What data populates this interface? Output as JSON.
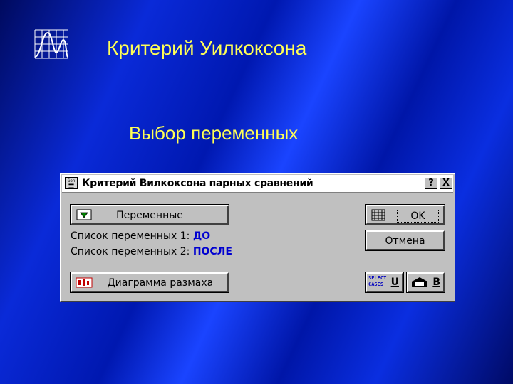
{
  "slide": {
    "title": "Критерий Уилкоксона",
    "subtitle": "Выбор переменных",
    "logo_icon": "distribution-chart-icon"
  },
  "dialog": {
    "title": "Критерий Вилкоксона парных сравнений",
    "help_label": "?",
    "close_label": "X",
    "variables_button": "Переменные",
    "var_list_1_label": "Список переменных 1:",
    "var_list_1_value": "ДО",
    "var_list_2_label": "Список переменных 2:",
    "var_list_2_value": "ПОСЛЕ",
    "boxplot_button": "Диаграмма размаха",
    "ok_button": "OK",
    "cancel_button": "Отмена",
    "select_cases_line1": "SELECT",
    "select_cases_line2": "CASES",
    "select_cases_key": "U",
    "weight_key": "B",
    "sys_icon_text": "Gen"
  },
  "colors": {
    "title_text": "#ffff55",
    "value_text": "#0000d0",
    "dialog_bg": "#c0c0c0"
  }
}
